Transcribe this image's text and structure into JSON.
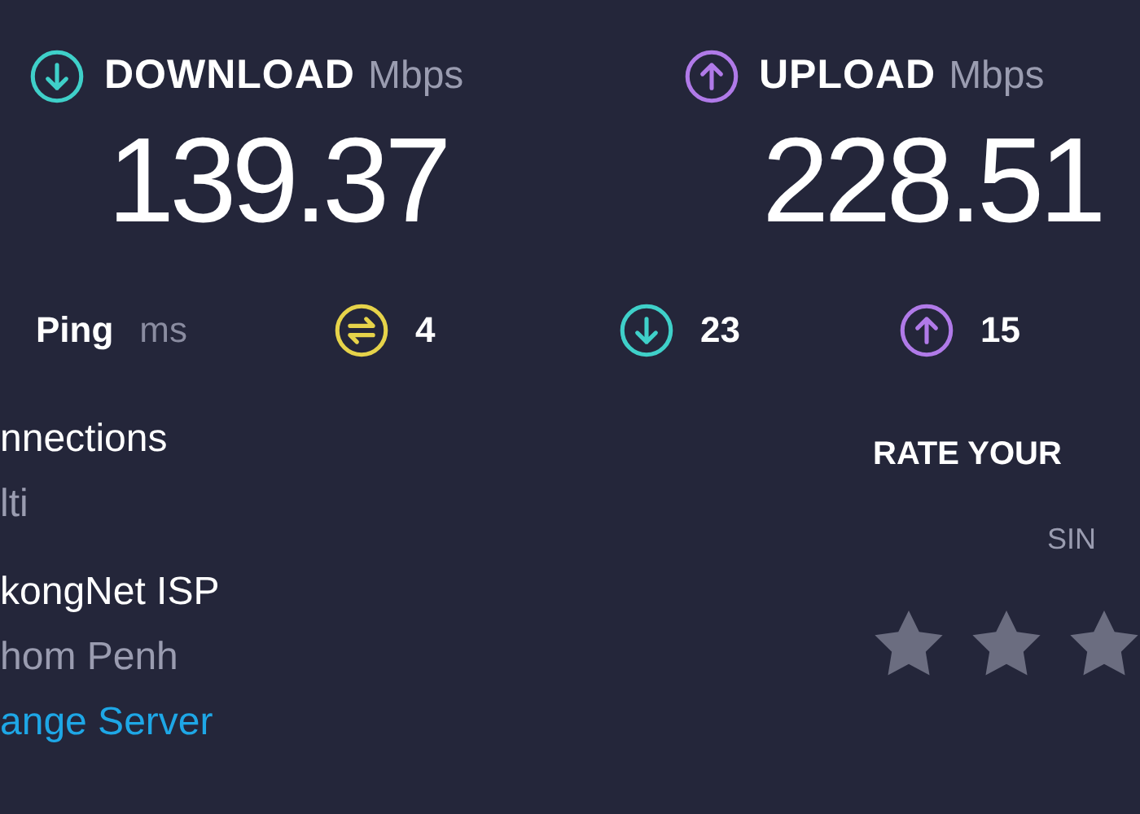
{
  "results": [
    {
      "kind": "download",
      "label": "DOWNLOAD",
      "unit": "Mbps",
      "value": "139.37"
    },
    {
      "kind": "upload",
      "label": "UPLOAD",
      "unit": "Mbps",
      "value": "228.51"
    }
  ],
  "ping": {
    "label": "Ping",
    "unit": "ms",
    "readings": [
      {
        "kind": "idle",
        "value": "4"
      },
      {
        "kind": "download",
        "value": "23"
      },
      {
        "kind": "upload",
        "value": "15"
      }
    ]
  },
  "connections": {
    "title": "nnections",
    "value": "lti"
  },
  "server": {
    "isp": "kongNet ISP",
    "location": "hom Penh",
    "change_link": "ange Server"
  },
  "rating": {
    "title": "RATE YOUR",
    "subtitle": "SIN",
    "stars": 0
  }
}
